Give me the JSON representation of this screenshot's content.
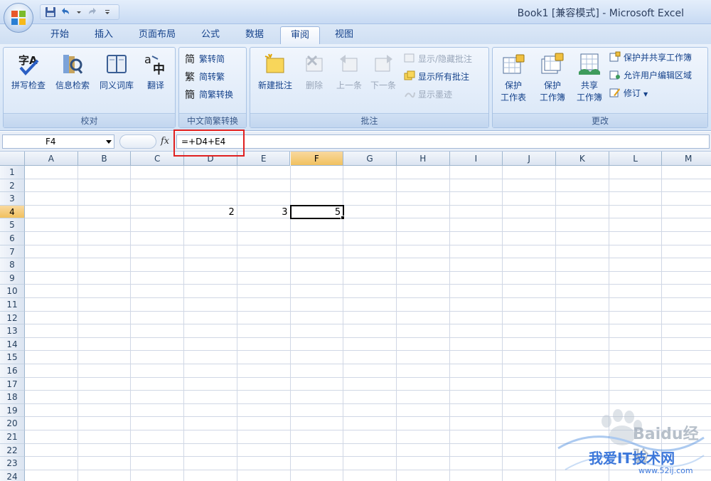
{
  "window": {
    "title": "Book1  [兼容模式] - Microsoft Excel"
  },
  "tabs": [
    "开始",
    "插入",
    "页面布局",
    "公式",
    "数据",
    "审阅",
    "视图"
  ],
  "active_tab": "审阅",
  "ribbon": {
    "proofing": {
      "label": "校对",
      "spell": "拼写检查",
      "research": "信息检索",
      "thesaurus": "同义词库",
      "translate": "翻译"
    },
    "chinese_conv": {
      "label": "中文简繁转换",
      "to_simplified": "繁转简",
      "to_traditional": "简转繁",
      "convert": "简繁转换"
    },
    "comments": {
      "label": "批注",
      "new": "新建批注",
      "delete": "删除",
      "prev": "上一条",
      "next": "下一条",
      "show_hide": "显示/隐藏批注",
      "show_all": "显示所有批注",
      "show_ink": "显示墨迹"
    },
    "changes": {
      "label": "更改",
      "protect_sheet_1": "保护",
      "protect_sheet_2": "工作表",
      "protect_book_1": "保护",
      "protect_book_2": "工作簿",
      "share_book_1": "共享",
      "share_book_2": "工作簿",
      "protect_share": "保护并共享工作簿",
      "allow_edit": "允许用户编辑区域",
      "track": "修订"
    }
  },
  "formula_bar": {
    "name_box": "F4",
    "fx": "fx",
    "formula": "=+D4+E4"
  },
  "grid": {
    "columns": [
      "A",
      "B",
      "C",
      "D",
      "E",
      "F",
      "G",
      "H",
      "I",
      "J",
      "K",
      "L",
      "M"
    ],
    "rows": [
      "1",
      "2",
      "3",
      "4",
      "5",
      "6",
      "7",
      "8",
      "9",
      "10",
      "11",
      "12",
      "13",
      "14",
      "15",
      "16",
      "17",
      "18",
      "19",
      "20",
      "21",
      "22",
      "23",
      "24"
    ],
    "active_cell": "F4",
    "cells": {
      "D4": "2",
      "E4": "3",
      "F4": "5"
    }
  },
  "watermark": {
    "baidu": "Baidu经验",
    "site_cn": "我爱IT技术网",
    "site": "www.52ij.com"
  },
  "colors": {
    "accent": "#15428b",
    "highlight": "#e02020",
    "active_header": "#f1c15f"
  }
}
